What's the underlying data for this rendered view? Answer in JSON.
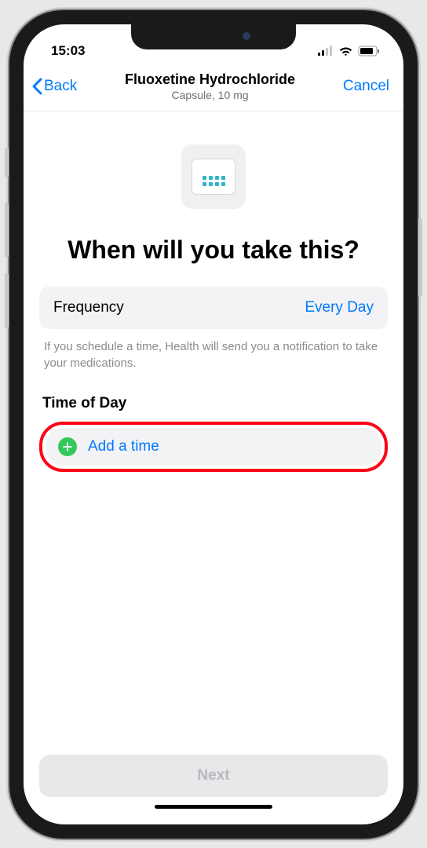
{
  "status": {
    "time": "15:03"
  },
  "nav": {
    "back_label": "Back",
    "title": "Fluoxetine Hydrochloride",
    "subtitle": "Capsule, 10 mg",
    "cancel_label": "Cancel"
  },
  "headline": "When will you take this?",
  "frequency": {
    "label": "Frequency",
    "value": "Every Day"
  },
  "helper_text": "If you schedule a time, Health will send you a notification to take your medications.",
  "time_section": {
    "header": "Time of Day",
    "add_label": "Add a time"
  },
  "footer": {
    "next_label": "Next"
  },
  "colors": {
    "accent": "#007aff",
    "success": "#34c759",
    "highlight_ring": "#ff0014"
  }
}
